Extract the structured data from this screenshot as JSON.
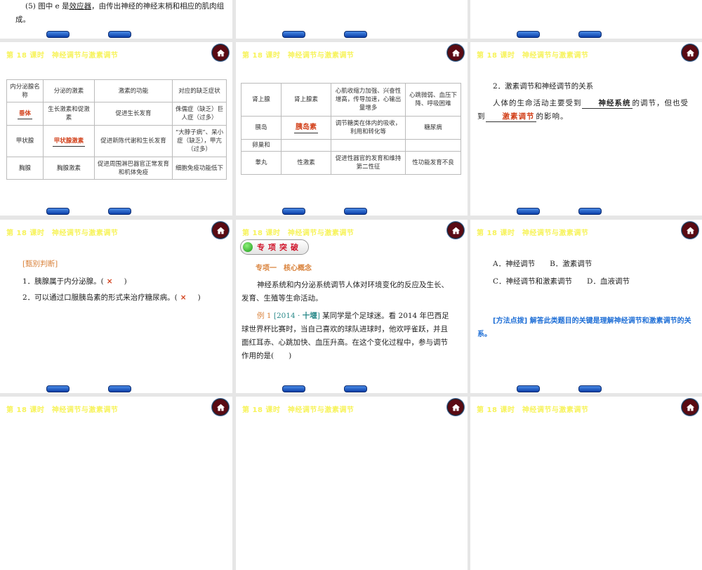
{
  "header": {
    "title": "第 18 课时　神经调节与激素调节"
  },
  "slide1": {
    "prefix": "(5) 图中 e 是",
    "answer": "效应器",
    "suffix": "，由传出神经的神经末梢和相应的肌肉组成。"
  },
  "table1": {
    "headers": [
      "内分泌腺名称",
      "分泌的激素",
      "激素的功能",
      "对应的缺乏症状"
    ],
    "rows": [
      [
        "垂体",
        "生长激素和促激素",
        "促进生长发育",
        "侏儒症（缺乏）巨人症（过多）"
      ],
      [
        "甲状腺",
        "甲状腺激素",
        "促进新陈代谢和生长发育",
        "“大脖子病”、呆小症（缺乏），甲亢（过多）"
      ],
      [
        "胸腺",
        "胸腺激素",
        "促进周围淋巴器官正常发育和机体免疫",
        "细胞免疫功能低下"
      ]
    ]
  },
  "table2": {
    "rows": [
      [
        "肾上腺",
        "肾上腺素",
        "心肌收缩力加强、兴奋性增高，传导加速，心输出量增多",
        "心跳微弱、血压下降、呼吸困难"
      ],
      [
        "胰岛",
        "胰岛素",
        "调节糖类在体内的吸收，利用和转化等",
        "糖尿病"
      ],
      [
        "卵巢和",
        "",
        "",
        ""
      ],
      [
        "睾丸",
        "性激素",
        "促进性器官的发育和维持第二性征",
        "性功能发育不良"
      ]
    ]
  },
  "slide3": {
    "heading": "2．激素调节和神经调节的关系",
    "p1": "人体的生命活动主要受到",
    "a1": "神经系统",
    "p2": "的调节，但也受到",
    "a2": "激素调节",
    "p3": "的影响。"
  },
  "slide4": {
    "label": "[甄别判断]",
    "q1": "1．胰腺属于内分泌腺。(",
    "q1_mark": "×",
    "q2": "2．可以通过口服胰岛素的形式来治疗糖尿病。(",
    "q2_mark": "×",
    "close": ")"
  },
  "slide5": {
    "badge": "专项突破",
    "section": "专项一　核心概念",
    "para": "神经系统和内分泌系统调节人体对环境变化的反应及生长、发育、生殖等生命活动。",
    "example_label": "例 1",
    "example_source_a": "[2014 · ",
    "example_source_b": "十堰",
    "example_source_c": "]",
    "question": "某同学是个足球迷。看 2014 年巴西足球世界杯比赛时，当自己喜欢的球队进球时，他欢呼雀跃，并且面红耳赤、心跳加快、血压升高。在这个变化过程中，参与调节作用的是(　　)"
  },
  "slide6": {
    "optA": "A．神经调节",
    "optB": "B．激素调节",
    "optC": "C．神经调节和激素调节",
    "optD": "D．血液调节",
    "tip_label": "[方法点拨]",
    "tip": "解答此类题目的关键是理解神经调节和激素调节的关系。"
  },
  "colors": {
    "title": "#f7f35a",
    "answer": "#d2401a",
    "home": "#5a0a14",
    "tip": "#1f6fd6"
  }
}
